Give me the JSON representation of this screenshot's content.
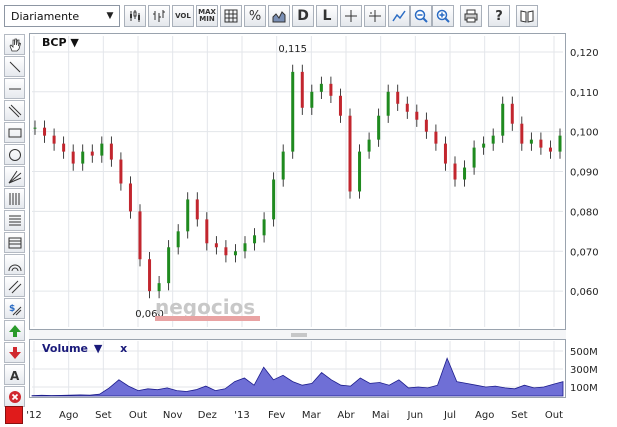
{
  "toolbar": {
    "period": "Diariamente",
    "vol_label": "VOL",
    "maxmin_top": "MAX",
    "maxmin_bottom": "MIN",
    "percent_label": "%",
    "d_label": "D",
    "l_label": "L",
    "help_label": "?"
  },
  "chart": {
    "symbol": "BCP",
    "symbol_menu_icon": "caret-down-icon",
    "watermark": "negocios",
    "annotations": {
      "high": "0,115",
      "low": "0,060"
    },
    "y_ticks": [
      "0,120",
      "0,110",
      "0,100",
      "0,090",
      "0,080",
      "0,070",
      "0,060"
    ],
    "x_ticks": [
      "'12",
      "Ago",
      "Set",
      "Out",
      "Nov",
      "Dez",
      "'13",
      "Fev",
      "Mar",
      "Abr",
      "Mai",
      "Jun",
      "Jul",
      "Ago",
      "Set",
      "Out"
    ]
  },
  "volume": {
    "title": "Volume",
    "title_menu_icon": "caret-down-icon",
    "close_label": "x",
    "y_ticks": [
      "500M",
      "300M",
      "100M"
    ]
  },
  "chart_data": {
    "type": "line",
    "series": [
      {
        "values": [
          0.101,
          0.099,
          0.097,
          0.095,
          0.092,
          0.095,
          0.094,
          0.097,
          0.093,
          0.087,
          0.08,
          0.068,
          0.06,
          0.062,
          0.071,
          0.075,
          0.083,
          0.078,
          0.072,
          0.071,
          0.069,
          0.07,
          0.072,
          0.074,
          0.078,
          0.088,
          0.095,
          0.115,
          0.106,
          0.11,
          0.112,
          0.109,
          0.104,
          0.085,
          0.095,
          0.098,
          0.104,
          0.11,
          0.107,
          0.105,
          0.103,
          0.1,
          0.097,
          0.092,
          0.088,
          0.091,
          0.096,
          0.097,
          0.099,
          0.107,
          0.102,
          0.097,
          0.098,
          0.096,
          0.095,
          0.099
        ]
      }
    ],
    "volume_series": [
      5,
      8,
      6,
      7,
      9,
      12,
      10,
      20,
      90,
      180,
      110,
      60,
      80,
      70,
      90,
      60,
      50,
      70,
      110,
      60,
      80,
      160,
      200,
      120,
      320,
      180,
      230,
      160,
      120,
      140,
      260,
      180,
      120,
      110,
      200,
      140,
      150,
      120,
      180,
      90,
      100,
      90,
      120,
      420,
      160,
      140,
      120,
      100,
      110,
      90,
      80,
      120,
      90,
      100,
      130,
      160
    ],
    "price_ylim": [
      0.051,
      0.124
    ],
    "volume_ylim": [
      0,
      600
    ],
    "grid": true
  },
  "colors": {
    "up": "#1f8a1f",
    "down": "#c2262e",
    "volume_fill": "#6f6fd6",
    "volume_stroke": "#1c1c8c",
    "grid": "#e3e6ea"
  }
}
